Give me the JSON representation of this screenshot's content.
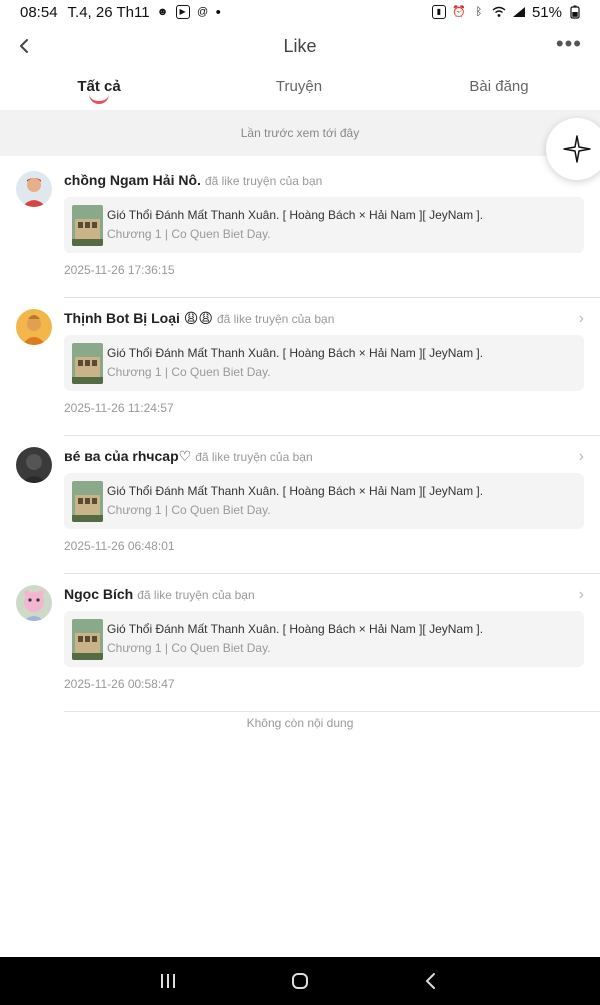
{
  "status": {
    "time": "08:54",
    "date": "T.4, 26 Th11",
    "notif_dot": "•",
    "battery": "51%"
  },
  "header": {
    "title": "Like"
  },
  "tabs": [
    {
      "label": "Tất cả",
      "active": true
    },
    {
      "label": "Truyện",
      "active": false
    },
    {
      "label": "Bài đăng",
      "active": false
    }
  ],
  "last_seen": "Lần trước xem tới đây",
  "items": [
    {
      "user": "chồng Ngam Hải Nô.",
      "action": "đã like truyện của bạn",
      "title": "Gió Thổi Đánh Mất Thanh Xuân. [ Hoàng Bách × Hải Nam ][ JeyNam ].",
      "chapter": "Chương 1 | Co Quen Biet Day.",
      "time": "2025-11-26 17:36:15",
      "has_chevron": false
    },
    {
      "user": "Thịnh Bot Bị Loại 😩😩",
      "action": "đã like truyện của bạn",
      "title": "Gió Thổi Đánh Mất Thanh Xuân. [ Hoàng Bách × Hải Nam ][ JeyNam ].",
      "chapter": "Chương 1 | Co Quen Biet Day.",
      "time": "2025-11-26 11:24:57",
      "has_chevron": true
    },
    {
      "user": "вé ва của rhчcap♡",
      "action": "đã like truyện của bạn",
      "title": "Gió Thổi Đánh Mất Thanh Xuân. [ Hoàng Bách × Hải Nam ][ JeyNam ].",
      "chapter": "Chương 1 | Co Quen Biet Day.",
      "time": "2025-11-26 06:48:01",
      "has_chevron": true
    },
    {
      "user": "Ngọc Bích",
      "action": "đã like truyện của bạn",
      "title": "Gió Thổi Đánh Mất Thanh Xuân. [ Hoàng Bách × Hải Nam ][ JeyNam ].",
      "chapter": "Chương 1 | Co Quen Biet Day.",
      "time": "2025-11-26 00:58:47",
      "has_chevron": true
    }
  ],
  "no_more": "Không còn nội dung",
  "colors": {
    "accent": "#ef4b5e",
    "card_bg": "#f4f4f4",
    "banner_bg": "#f2f2f2"
  },
  "icons": [
    "back-arrow-icon",
    "more-dots-icon",
    "sparkle-icon",
    "chevron-right-icon",
    "recents-icon",
    "home-icon",
    "nav-back-icon"
  ]
}
